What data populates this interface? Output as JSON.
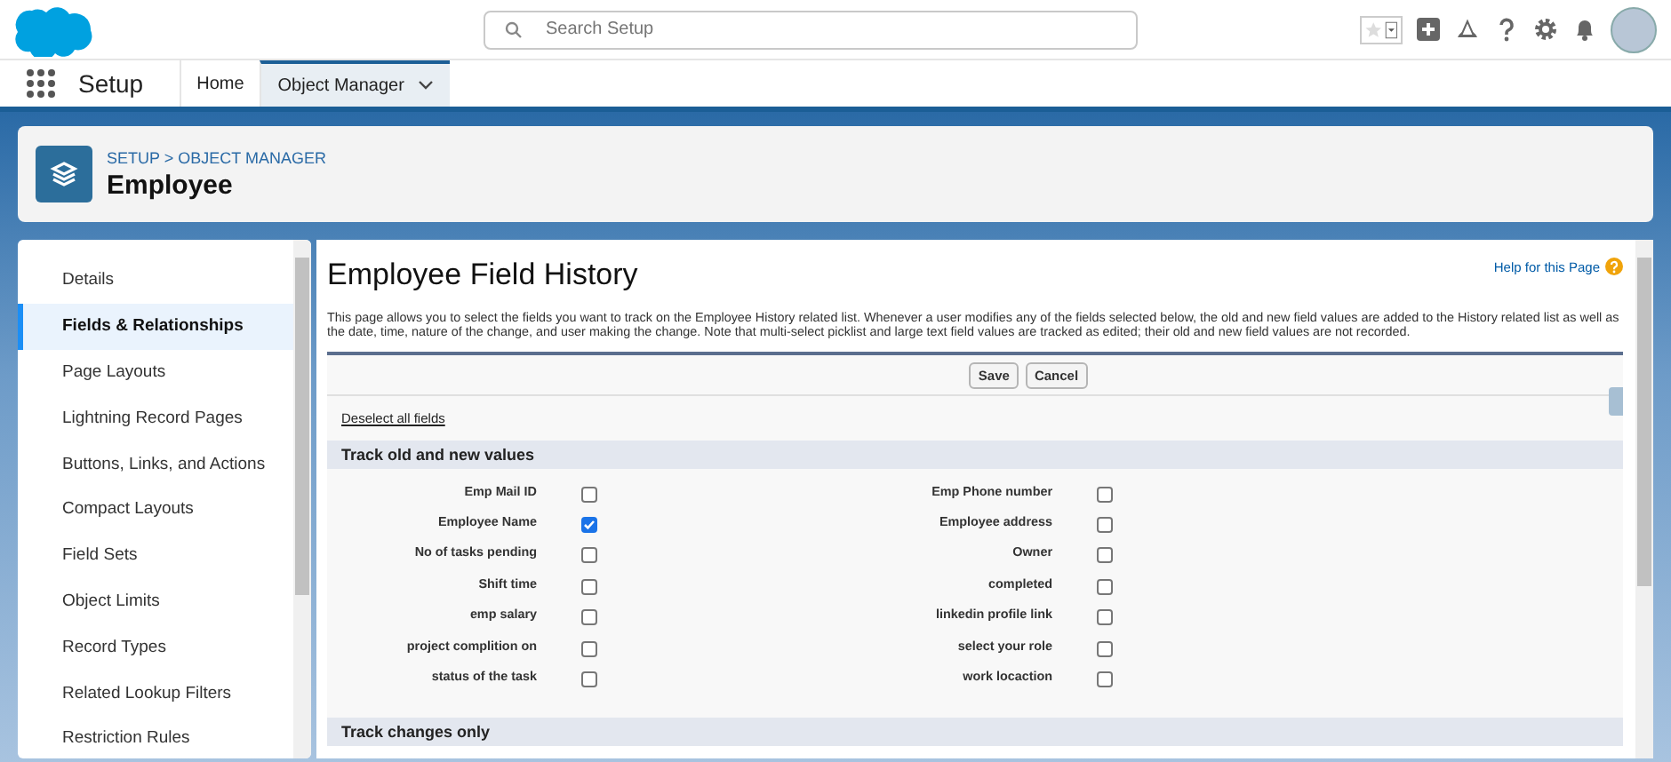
{
  "header": {
    "search": {
      "placeholder": "Search Setup"
    }
  },
  "nav": {
    "app_name": "Setup",
    "tabs": [
      {
        "label": "Home",
        "selected": false,
        "dropdown": false
      },
      {
        "label": "Object Manager",
        "selected": true,
        "dropdown": true
      }
    ]
  },
  "page_header": {
    "breadcrumb": "SETUP > OBJECT MANAGER",
    "title": "Employee"
  },
  "sidebar": {
    "items": [
      {
        "label": "Details",
        "selected": false
      },
      {
        "label": "Fields & Relationships",
        "selected": true
      },
      {
        "label": "Page Layouts",
        "selected": false
      },
      {
        "label": "Lightning Record Pages",
        "selected": false
      },
      {
        "label": "Buttons, Links, and Actions",
        "selected": false
      },
      {
        "label": "Compact Layouts",
        "selected": false
      },
      {
        "label": "Field Sets",
        "selected": false
      },
      {
        "label": "Object Limits",
        "selected": false
      },
      {
        "label": "Record Types",
        "selected": false
      },
      {
        "label": "Related Lookup Filters",
        "selected": false
      },
      {
        "label": "Restriction Rules",
        "selected": false
      }
    ]
  },
  "main": {
    "title": "Employee Field History",
    "help_link": "Help for this Page",
    "description": "This page allows you to select the fields you want to track on the Employee History related list. Whenever a user modifies any of the fields selected below, the old and new field values are added to the History related list as well as the date, time, nature of the change, and user making the change. Note that multi-select picklist and large text field values are tracked as edited; their old and new field values are not recorded.",
    "buttons": [
      "Save",
      "Cancel"
    ],
    "deselect_link": "Deselect all fields",
    "sections": [
      {
        "title": "Track old and new values",
        "fields": [
          {
            "label": "Emp Mail ID",
            "checked": false
          },
          {
            "label": "Emp Phone number",
            "checked": false
          },
          {
            "label": "Employee Name",
            "checked": true
          },
          {
            "label": "Employee address",
            "checked": false
          },
          {
            "label": "No of tasks pending",
            "checked": false
          },
          {
            "label": "Owner",
            "checked": false
          },
          {
            "label": "Shift time",
            "checked": false
          },
          {
            "label": "completed",
            "checked": false
          },
          {
            "label": "emp salary",
            "checked": false
          },
          {
            "label": "linkedin profile link",
            "checked": false
          },
          {
            "label": "project complition on",
            "checked": false
          },
          {
            "label": "select your role",
            "checked": false
          },
          {
            "label": "status of the task",
            "checked": false
          },
          {
            "label": "work locaction",
            "checked": false
          }
        ]
      },
      {
        "title": "Track changes only"
      }
    ]
  }
}
